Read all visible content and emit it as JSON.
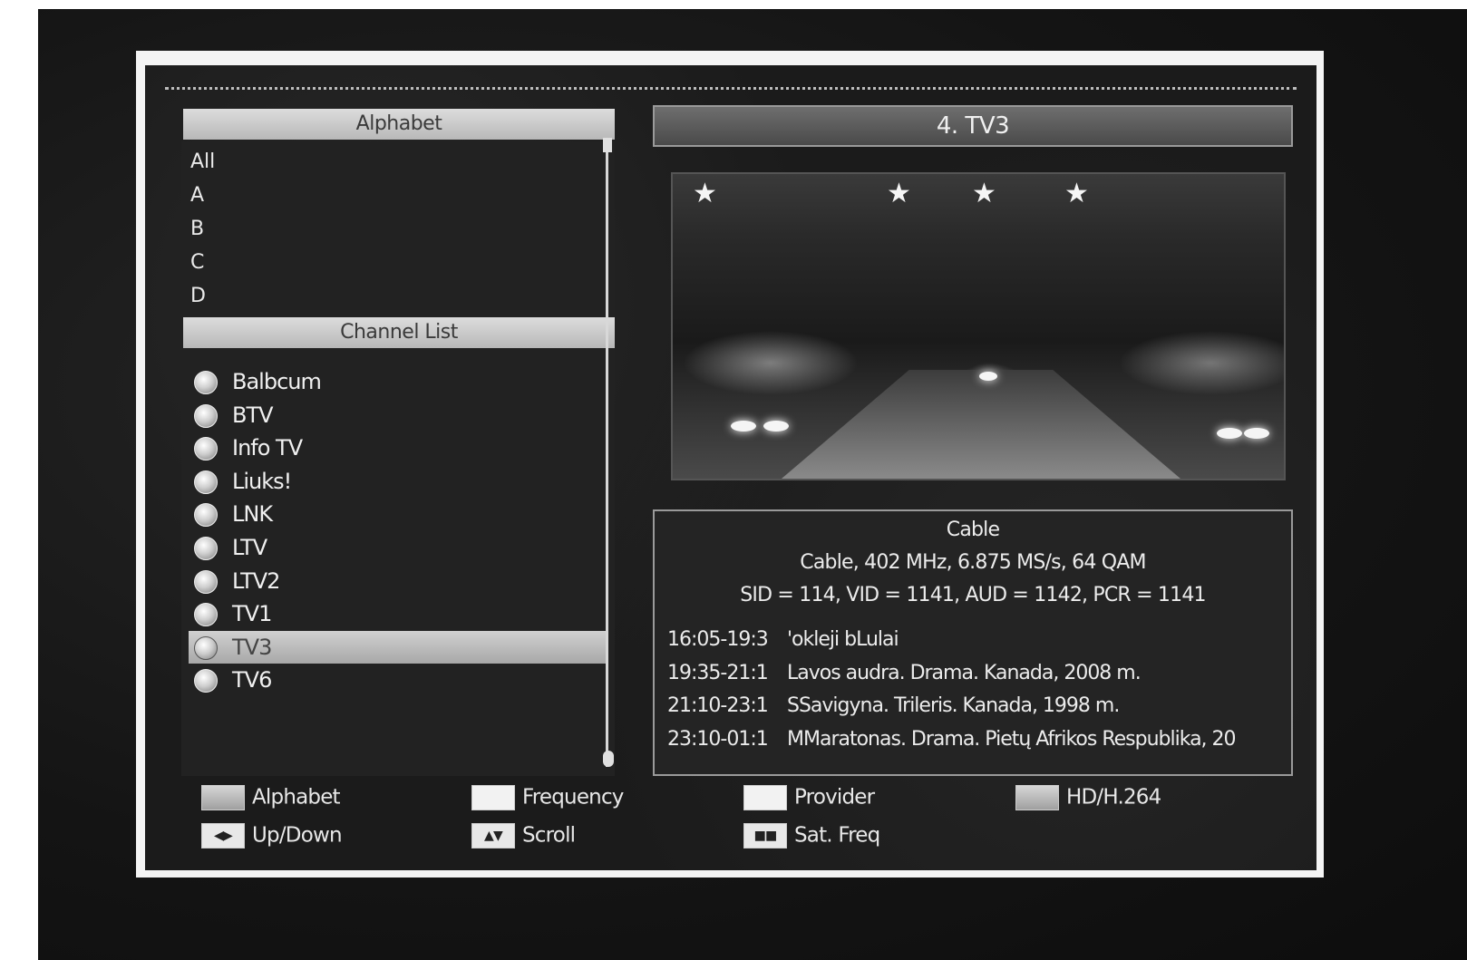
{
  "alphabet": {
    "header": "Alphabet",
    "items": [
      "All",
      "A",
      "B",
      "C",
      "D"
    ]
  },
  "channel_list": {
    "header": "Channel List",
    "selected_index": 8,
    "items": [
      "Balbcum",
      "BTV",
      "Info TV",
      "Liuks!",
      "LNK",
      "LTV",
      "LTV2",
      "TV1",
      "TV3",
      "TV6"
    ]
  },
  "current_channel": {
    "title": "4. TV3"
  },
  "info": {
    "source": "Cable",
    "tuning": "Cable, 402 MHz, 6.875 MS/s, 64 QAM",
    "pids": "SID = 114, VID = 1141, AUD = 1142, PCR = 1141",
    "epg": [
      {
        "time": "16:05-19:3",
        "title": "'okleji bLulai"
      },
      {
        "time": "19:35-21:1",
        "title": "Lavos audra. Drama.  Kanada, 2008 m."
      },
      {
        "time": "21:10-23:1",
        "title": "SSavigyna. Trileris. Kanada, 1998 m."
      },
      {
        "time": "23:10-01:1",
        "title": "MMaratonas. Drama. Pietų Afrikos Respublika, 20"
      }
    ]
  },
  "legend": {
    "alphabet": "Alphabet",
    "frequency": "Frequency",
    "provider": "Provider",
    "hd": "HD/H.264",
    "updown": "Up/Down",
    "scroll": "Scroll",
    "satfreq": "Sat. Freq"
  },
  "colors": {
    "screen_bg": "#1b1b1b",
    "header_light": "#c8c8c8",
    "header_dark": "#5a5a5a",
    "frame": "#f4f4f4"
  },
  "icons": {
    "channel": "globe-icon",
    "updown_key": "left-right-arrow-key-icon",
    "scroll_key": "page-key-icon",
    "satfreq_key": "info-key-icon"
  }
}
